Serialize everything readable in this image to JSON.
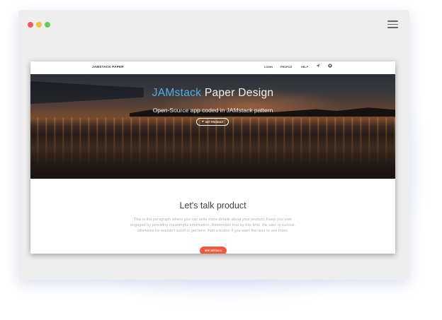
{
  "window": {
    "controls": [
      "close",
      "minimize",
      "zoom"
    ],
    "menu_icon": "hamburger-icon"
  },
  "navbar": {
    "brand": "JAMSTACK PAPER",
    "links": [
      "LOGIN",
      "PROFILE",
      "HELP"
    ],
    "icons": [
      "send-icon",
      "github-icon"
    ]
  },
  "hero": {
    "title_accent": "JAMstack",
    "title_rest": "Paper Design",
    "subtitle": "Open-Source app coded in JAMstack pattern",
    "cta_label": "GET PRODUCT",
    "cta_icon": "send-icon"
  },
  "product": {
    "title": "Let's talk product",
    "text": "This is the paragraph where you can write more details about your product. Keep you user engaged by providing meaningful information. Remember that by this time, the user is curious, otherwise he wouldn't scroll to get here. Add a button if you want the user to see more.",
    "button_label": "SEE DETAILS"
  },
  "colors": {
    "accent": "#4fb0e8",
    "button": "#f0593c",
    "close": "#f25b5b",
    "minimize": "#f2c23b",
    "zoom": "#5cd05c"
  }
}
